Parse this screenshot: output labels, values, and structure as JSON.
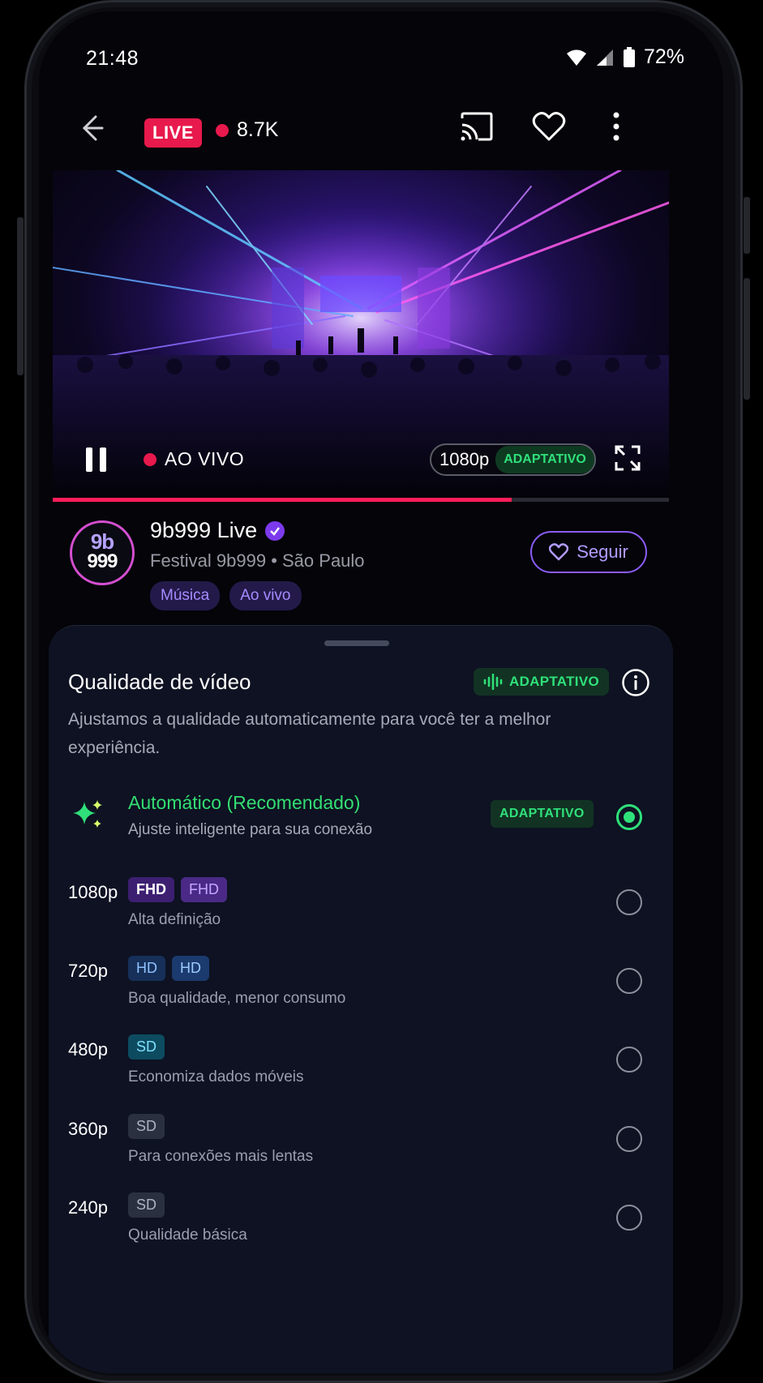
{
  "status_bar": {
    "time": "21:48",
    "battery": "72%"
  },
  "top_bar": {
    "live_label": "LIVE",
    "viewers": "8.7K"
  },
  "player": {
    "live_indicator": "AO VIVO",
    "resolution": "1080p",
    "mode": "ADAPTATIVO",
    "progress_fraction": 0.745
  },
  "channel": {
    "avatar_line1": "9b",
    "avatar_line2": "999",
    "name": "9b999 Live",
    "subtitle": "Festival 9b999 • São Paulo",
    "tags": [
      "Música",
      "Ao vivo"
    ],
    "follow_label": "Seguir"
  },
  "sheet": {
    "title": "Qualidade de vídeo",
    "badge": "ADAPTATIVO",
    "description": "Ajustamos a qualidade automaticamente para você ter a melhor experiência.",
    "auto": {
      "title": "Automático (Recomendado)",
      "desc": "Ajuste inteligente para sua conexão",
      "badge": "ADAPTATIVO",
      "selected": true
    },
    "options": [
      {
        "res": "1080p",
        "badges": [
          "FHD",
          "FHD"
        ],
        "desc": "Alta definição"
      },
      {
        "res": "720p",
        "badges": [
          "HD",
          "HD"
        ],
        "desc": "Boa qualidade, menor consumo"
      },
      {
        "res": "480p",
        "badges": [
          "SD"
        ],
        "desc": "Economiza dados móveis"
      },
      {
        "res": "360p",
        "badges": [
          "SD"
        ],
        "desc": "Para conexões mais lentas"
      },
      {
        "res": "240p",
        "badges": [
          "SD"
        ],
        "desc": "Qualidade básica"
      }
    ]
  },
  "colors": {
    "accent_live": "#e8194c",
    "accent_green": "#2fe07a",
    "accent_purple": "#8b5cf6",
    "sheet_bg": "#0e1222"
  }
}
